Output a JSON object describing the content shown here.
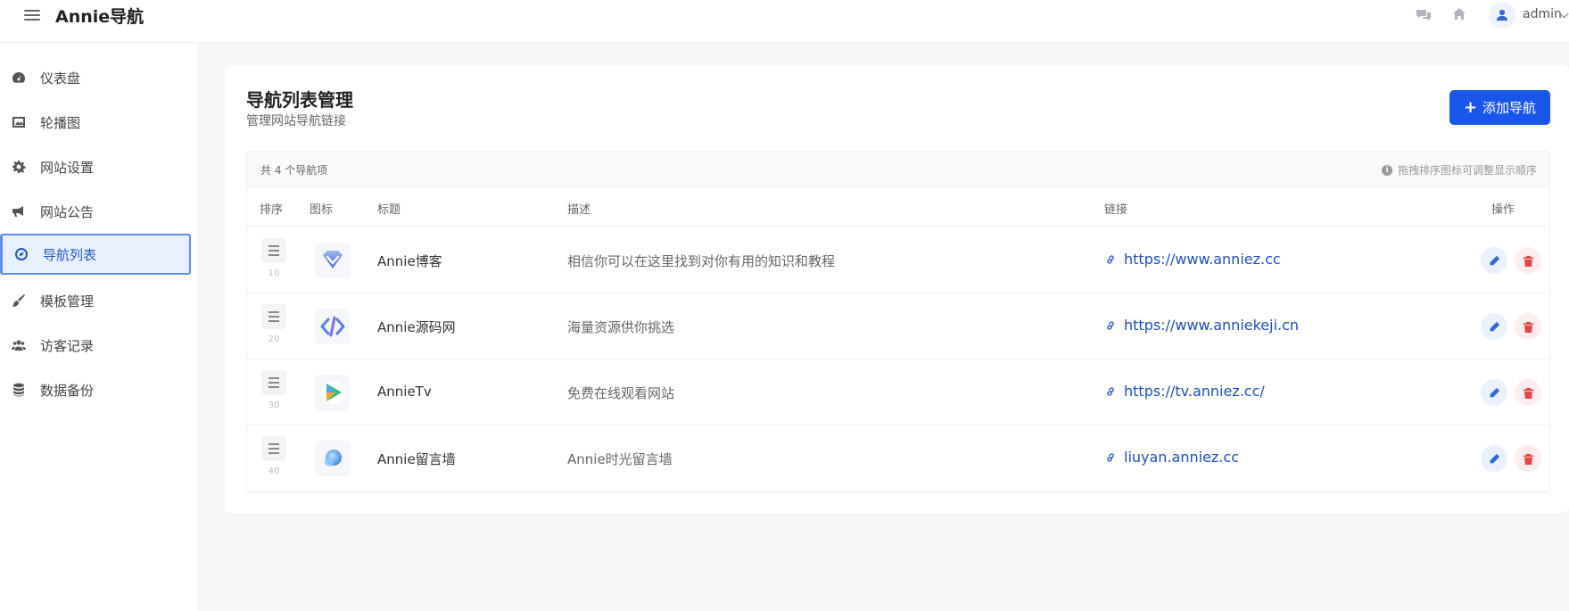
{
  "header": {
    "brand": "Annie导航",
    "user": "admin",
    "icons": [
      "menu-icon",
      "chat-icon",
      "home-icon",
      "user-icon",
      "chevron-down-icon"
    ]
  },
  "sidebar": {
    "items": [
      {
        "label": "仪表盘",
        "icon": "dashboard-icon"
      },
      {
        "label": "轮播图",
        "icon": "image-icon"
      },
      {
        "label": "网站设置",
        "icon": "gear-icon"
      },
      {
        "label": "网站公告",
        "icon": "megaphone-icon"
      },
      {
        "label": "导航列表",
        "icon": "compass-icon",
        "active": true
      },
      {
        "label": "模板管理",
        "icon": "brush-icon"
      },
      {
        "label": "访客记录",
        "icon": "users-icon"
      },
      {
        "label": "数据备份",
        "icon": "database-icon"
      }
    ]
  },
  "main": {
    "title": "导航列表管理",
    "subtitle": "管理网站导航链接",
    "add_button": "添加导航",
    "count_text": "共 4 个导航项",
    "hint_text": "拖拽排序图标可调整显示顺序",
    "columns": [
      "排序",
      "图标",
      "标题",
      "描述",
      "链接",
      "操作"
    ],
    "rows": [
      {
        "order": "10",
        "title": "Annie博客",
        "description": "相信你可以在这里找到对你有用的知识和教程",
        "link": "https://www.anniez.cc",
        "icon": "diamond-icon"
      },
      {
        "order": "20",
        "title": "Annie源码网",
        "description": "海量资源供你挑选",
        "link": "https://www.anniekeji.cn",
        "icon": "code-icon"
      },
      {
        "order": "30",
        "title": "AnnieTv",
        "description": "免费在线观看网站",
        "link": "https://tv.anniez.cc/",
        "icon": "play-icon"
      },
      {
        "order": "40",
        "title": "Annie留言墙",
        "description": "Annie时光留言墙",
        "link": "liuyan.anniez.cc",
        "icon": "bubble-icon"
      }
    ]
  },
  "colors": {
    "primary": "#1a57e8",
    "link": "#1d4fb5",
    "active_bg": "#e9f0fd",
    "edit": "#2f6bd6",
    "delete": "#e04848"
  }
}
